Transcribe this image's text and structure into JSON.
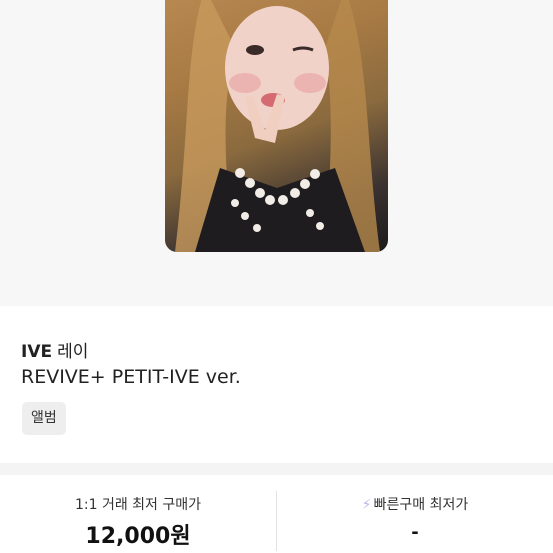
{
  "product": {
    "image_alt": "IVE 레이 photocard",
    "brand": "IVE",
    "member": "레이",
    "album_version": "REVIVE+ PETIT-IVE ver.",
    "category_tag": "앨범"
  },
  "prices": {
    "lowest_1on1": {
      "label": "1:1 거래 최저 구매가",
      "value": "12,000원"
    },
    "quick_buy": {
      "icon": "lightning-icon",
      "label": "빠른구매 최저가",
      "value": "-"
    }
  },
  "colors": {
    "hero_background": "#f7f7f7",
    "tag_background": "#eeeeee",
    "accent_lightning": "#b9b9e8"
  }
}
